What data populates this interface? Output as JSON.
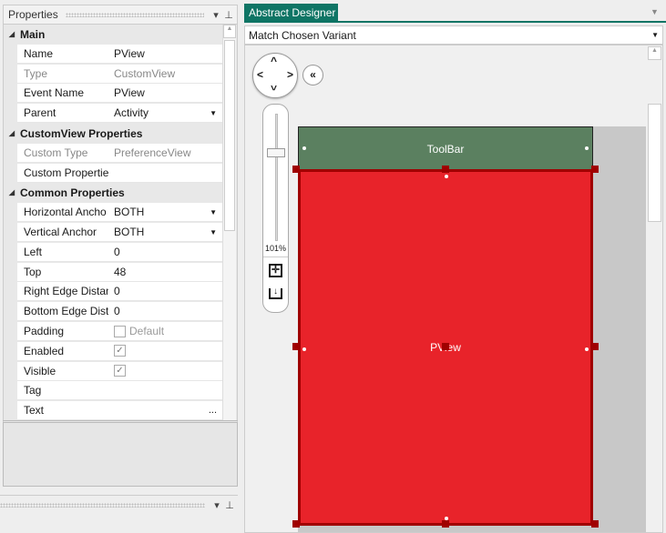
{
  "properties_panel": {
    "title": "Properties",
    "categories": [
      {
        "label": "Main",
        "rows": [
          {
            "name": "Name",
            "value": "PView"
          },
          {
            "name": "Type",
            "value": "CustomView",
            "disabled": true
          },
          {
            "name": "Event Name",
            "value": "PView"
          },
          {
            "name": "Parent",
            "value": "Activity",
            "dropdown": true
          }
        ]
      },
      {
        "label": "CustomView Properties",
        "rows": [
          {
            "name": "Custom Type",
            "value": "PreferenceView",
            "disabled": true
          },
          {
            "name": "Custom Propertie",
            "value": ""
          }
        ]
      },
      {
        "label": "Common Properties",
        "rows": [
          {
            "name": "Horizontal Ancho",
            "value": "BOTH",
            "dropdown": true
          },
          {
            "name": "Vertical Anchor",
            "value": "BOTH",
            "dropdown": true
          },
          {
            "name": "Left",
            "value": "0"
          },
          {
            "name": "Top",
            "value": "48"
          },
          {
            "name": "Right Edge Distan",
            "value": "0"
          },
          {
            "name": "Bottom Edge Dist",
            "value": "0"
          },
          {
            "name": "Padding",
            "checkbox": false,
            "value": "Default"
          },
          {
            "name": "Enabled",
            "checkbox": true
          },
          {
            "name": "Visible",
            "checkbox": true
          },
          {
            "name": "Tag",
            "value": ""
          },
          {
            "name": "Text",
            "value": "...",
            "ellipsis": true
          }
        ]
      }
    ]
  },
  "designer": {
    "tab": "Abstract Designer",
    "variant": "Match Chosen Variant",
    "zoom": "101%",
    "toolbar_label": "ToolBar",
    "view_label": "PView"
  },
  "colors": {
    "accent": "#0f7565",
    "toolbar": "#5b8060",
    "view": "#e8232a",
    "selection": "#a00000"
  }
}
